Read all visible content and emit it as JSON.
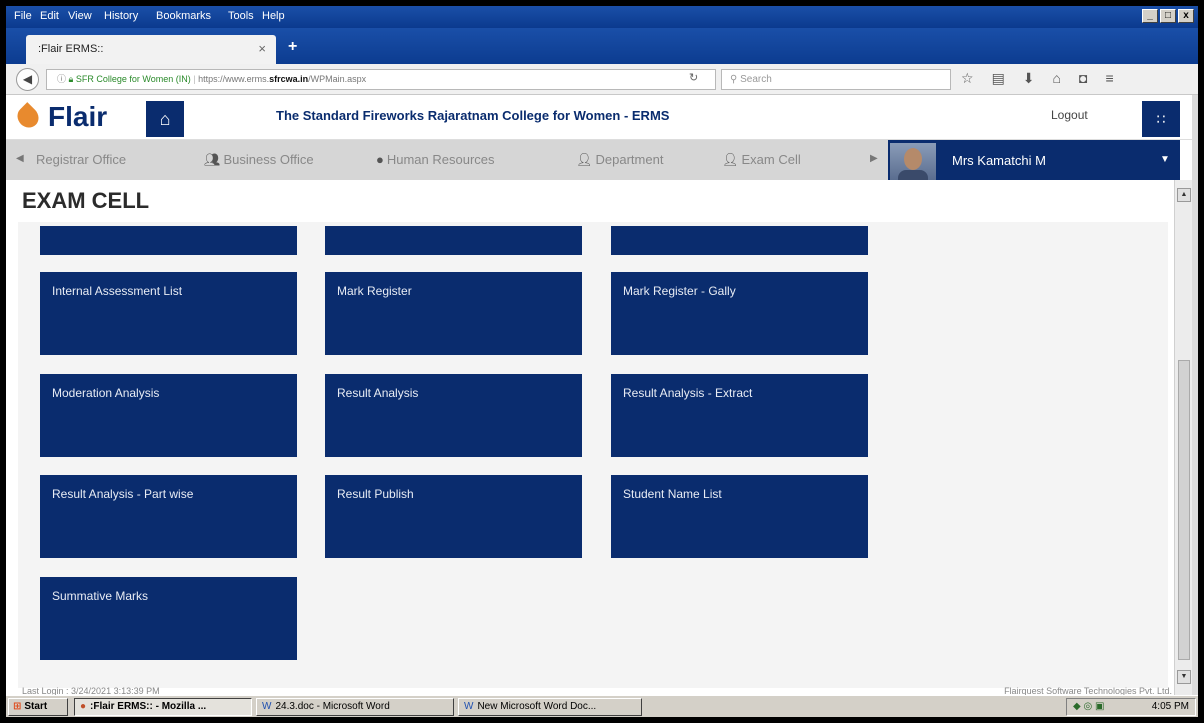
{
  "browser": {
    "menu": [
      "File",
      "Edit",
      "View",
      "History",
      "Bookmarks",
      "Tools",
      "Help"
    ],
    "tab_title": ":Flair ERMS::",
    "url": {
      "site_label": "SFR College for Women (IN)",
      "prefix": "https://www.erms.",
      "domain": "sfrcwa.in",
      "path": "/WPMain.aspx"
    },
    "search_placeholder": "Search"
  },
  "header": {
    "logo_text": "Flair",
    "college_title": "The Standard Fireworks Rajaratnam College for Women - ERMS",
    "logout_label": "Logout"
  },
  "modules": [
    {
      "label": "Registrar Office",
      "icon": "arrow-left-icon"
    },
    {
      "label": "Business Office",
      "icon": "users-icon"
    },
    {
      "label": "Human Resources",
      "icon": "people-icon"
    },
    {
      "label": "Department",
      "icon": "user-icon"
    },
    {
      "label": "Exam Cell",
      "icon": "user-gear-icon"
    }
  ],
  "user": {
    "name": "Mrs Kamatchi M"
  },
  "page": {
    "title": "EXAM CELL",
    "tiles": [
      "Internal Assessment List",
      "Mark Register",
      "Mark Register - Gally",
      "Moderation Analysis",
      "Result Analysis",
      "Result Analysis - Extract",
      "Result Analysis - Part wise",
      "Result Publish",
      "Student Name List",
      "Summative Marks"
    ]
  },
  "footer": {
    "left": "Last Login : 3/24/2021 3:13:39 PM",
    "right": "Flairquest Software Technologies Pvt. Ltd."
  },
  "taskbar": {
    "start_label": "Start",
    "tasks": [
      ":Flair ERMS:: - Mozilla ...",
      "24.3.doc - Microsoft Word",
      "New Microsoft Word Doc..."
    ],
    "clock": "4:05 PM"
  },
  "colors": {
    "brand_navy": "#0a2c6e",
    "logo_orange": "#e88a2e"
  }
}
